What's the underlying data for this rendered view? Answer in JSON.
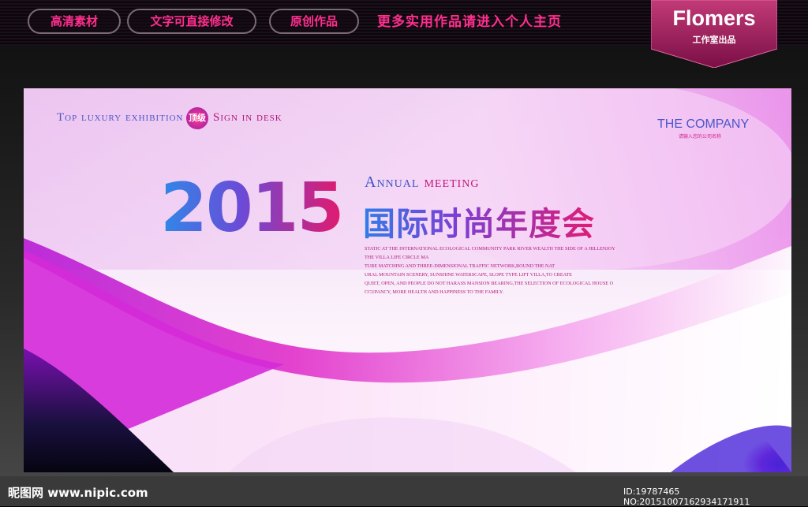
{
  "topbar": {
    "pills": [
      "高清素材",
      "文字可直接修改",
      "原创作品"
    ],
    "promo": "更多实用作品请进入个人主页"
  },
  "badge": {
    "name": "Flomers",
    "sub": "工作室出品"
  },
  "poster": {
    "tagline_left": "Top luxury exhibition",
    "tagline_badge": "顶级",
    "tagline_right": "Sign in desk",
    "company": "THE COMPANY",
    "company_sub": "请输入您的公司名称",
    "year": "2015",
    "annual_a": "Annual",
    "annual_b": "meeting",
    "title_cn": "国际时尚年度会",
    "body_lines": [
      "STATIC AT THE INTERNATIONAL ECOLOGICAL COMMUNITY PARK RIVER WEALTH THE SIDE OF A HILLENJOY",
      "THE VILLA LIFE CIRCLE MA",
      "TURE MATCHING AND THREE-DIMENSIONAL TRAFFIC NETWORK,ROUND THE NAT",
      "URAL MOUNTAIN SCENERY, SUNSHINE WATERSCAPE, SLOPE TYPE LIFT VILLA,TO CREATE",
      "QUIET, OPEN, AND PEOPLE DO NOT HARASS MANSION BEARING,THE SELECTION OF ECOLOGICAL HOUSE O",
      "CCUPANCY, MORE HEALTH AND HAPPINESS TO THE FAMILY."
    ]
  },
  "watermark": {
    "left": "昵图网 www.nipic.com",
    "right": "ID:19787465 NO:20151007162934171911"
  },
  "colors": {
    "accent_pink": "#ff2f8e",
    "accent_blue": "#4b56c8",
    "magenta": "#c2157b"
  }
}
